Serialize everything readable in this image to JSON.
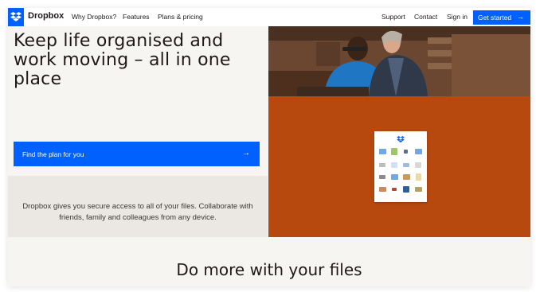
{
  "nav": {
    "brand": "Dropbox",
    "links": [
      "Why Dropbox?",
      "Features",
      "Plans & pricing"
    ],
    "right_links": [
      "Support",
      "Contact",
      "Sign in"
    ],
    "cta_label": "Get started"
  },
  "hero": {
    "headline": "Keep life organised and work moving – all in one place",
    "plan_button_label": "Find the plan for you",
    "description": "Dropbox gives you secure access to all of your files. Collaborate with friends, family and colleagues from any device."
  },
  "section": {
    "title": "Do more with your files"
  },
  "colors": {
    "brand_blue": "#0061fe",
    "orange_panel": "#b7490f",
    "light_background": "#f7f5f2",
    "description_background": "#ebe7e2"
  },
  "icons": [
    "dropbox-logo-icon",
    "arrow-right-icon"
  ]
}
